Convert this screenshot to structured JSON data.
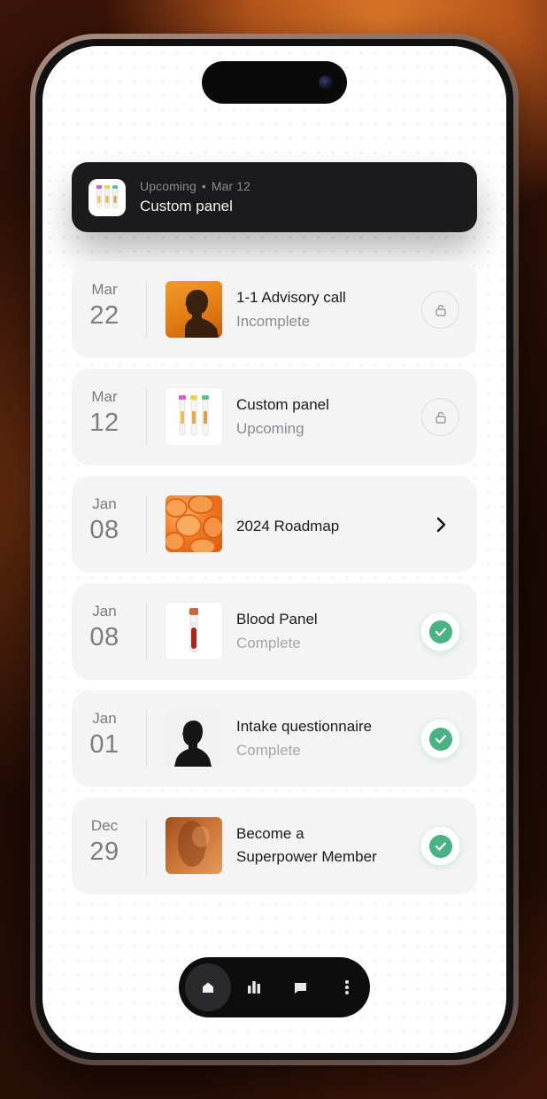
{
  "banner": {
    "status": "Upcoming",
    "separator": "•",
    "date": "Mar 12",
    "title": "Custom panel",
    "icon": "test-tubes-thumbnail"
  },
  "items": [
    {
      "month": "Mar",
      "day": "22",
      "title": "1-1 Advisory call",
      "subtitle": "Incomplete",
      "thumbnail": "silhouette-orange-portrait",
      "action": "lock-icon"
    },
    {
      "month": "Mar",
      "day": "12",
      "title": "Custom panel",
      "subtitle": "Upcoming",
      "thumbnail": "test-tubes",
      "action": "lock-icon"
    },
    {
      "month": "Jan",
      "day": "08",
      "title": "2024 Roadmap",
      "subtitle": "",
      "thumbnail": "orange-cells",
      "action": "chevron-right-icon"
    },
    {
      "month": "Jan",
      "day": "08",
      "title": "Blood Panel",
      "subtitle": "Complete",
      "thumbnail": "blood-tube",
      "action": "check-icon"
    },
    {
      "month": "Jan",
      "day": "01",
      "title": "Intake questionnaire",
      "subtitle": "Complete",
      "thumbnail": "silhouette-grey",
      "action": "check-icon"
    },
    {
      "month": "Dec",
      "day": "29",
      "title": "Become a Superpower Member",
      "title_line1": "Become a",
      "title_line2": "Superpower Member",
      "subtitle": "",
      "thumbnail": "orange-blur-figure",
      "action": "check-icon"
    }
  ],
  "tabbar": {
    "tabs": [
      "home-icon",
      "chart-icon",
      "chat-icon",
      "more-icon"
    ],
    "active": "home-icon"
  },
  "colors": {
    "banner_bg": "#1b1b1d",
    "card_bg": "#f4f4f5",
    "check_green": "#4ab384",
    "accent_orange": "#e07a14"
  }
}
